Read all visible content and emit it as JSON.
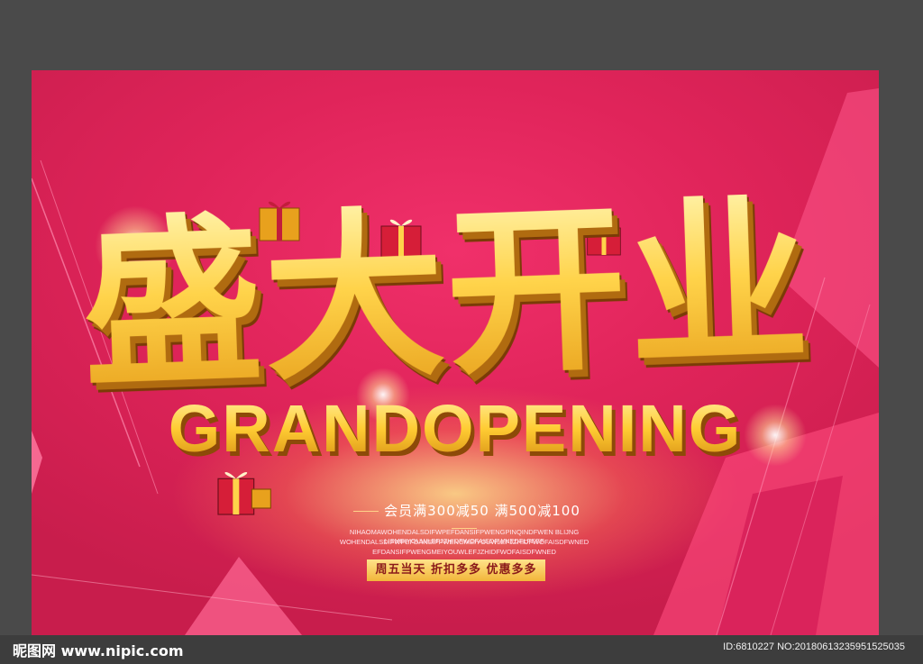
{
  "poster": {
    "title_cn": "盛大开业",
    "title_en": "GRANDOPENING",
    "promo": "会员满300减50 满500减100",
    "filler_lines": [
      "NIHAOMAWOHENDALSDIFWPEFDANSIFPWENGPINQINDFWEN BLIJNG LISMEIYOUWLEFJZHIDFWOFAISDFWNEDFLFEEF",
      "WOHENDALSDIFWPEFDANSIFPWENGMEIYOUWLEFJZHIDFWOFAISDFWNED",
      "EFDANSIFPWENGMEIYOUWLEFJZHIDFWOFAISDFWNED"
    ],
    "ribbon": "周五当天 折扣多多 优惠多多"
  },
  "watermark": {
    "logo": "昵图网 www.nipic.com",
    "id": "ID:6810227 NO:20180613235951525035"
  },
  "colors": {
    "background": "#4a4a4a",
    "poster_pink": "#e0245a",
    "gold": "#ffd34a",
    "ribbon": "#f2b63a"
  }
}
